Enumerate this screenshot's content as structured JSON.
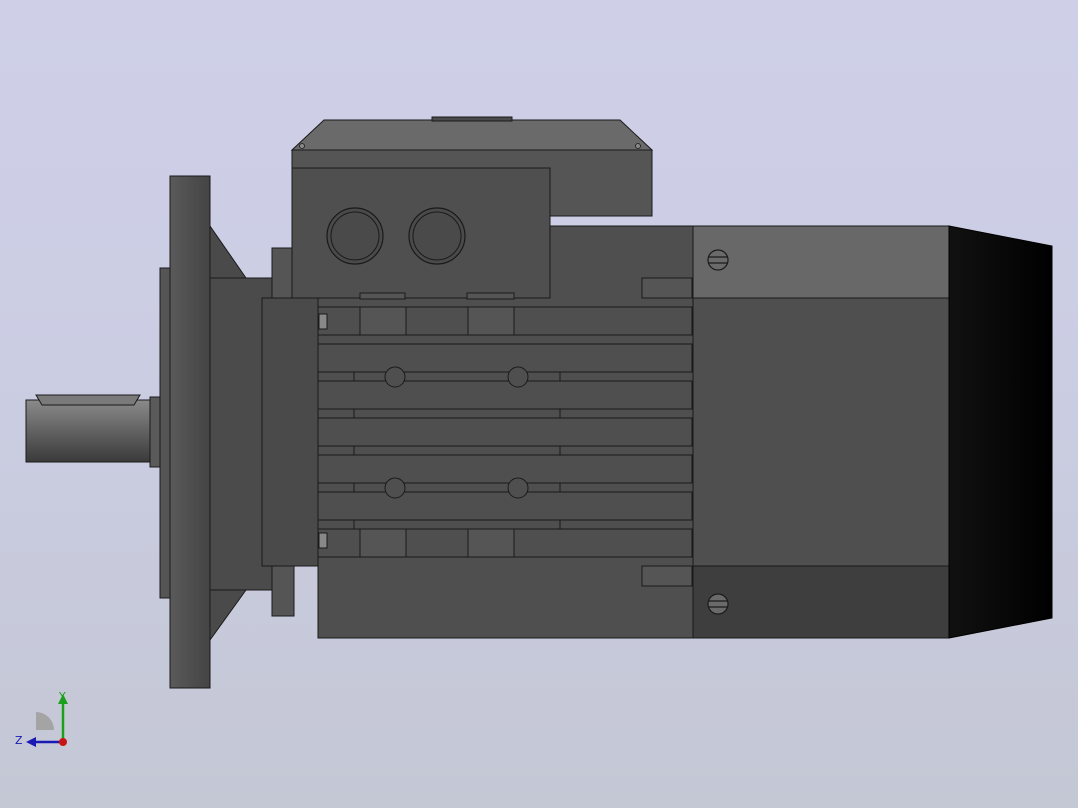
{
  "viewport": {
    "background_top": "#cfd0e8",
    "background_bottom": "#c4c7d4"
  },
  "model": {
    "description_icon": "electric-motor-model",
    "colors": {
      "body": "#4f4f4f",
      "body_light": "#5c5c5c",
      "terminal_box": "#6a6a6a",
      "fan_cover": "#0a0a0a",
      "edge": "#1a1a1a",
      "shaft": "#6b6b6b"
    }
  },
  "triad": {
    "y_label": "Y",
    "z_label": "Z",
    "y_color": "#1aa01a",
    "z_color": "#1a1ab4",
    "x_color": "#c81414"
  }
}
